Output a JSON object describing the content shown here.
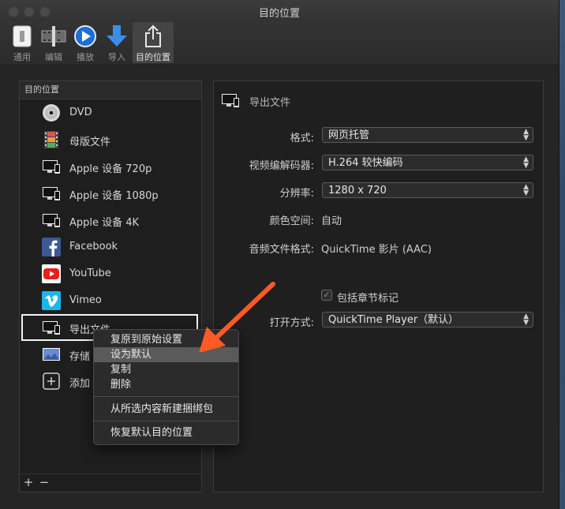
{
  "window": {
    "title": "目的位置"
  },
  "toolbar": {
    "items": [
      {
        "label": "通用"
      },
      {
        "label": "编辑"
      },
      {
        "label": "播放"
      },
      {
        "label": "导入"
      },
      {
        "label": "目的位置"
      }
    ]
  },
  "destinations": {
    "header": "目的位置",
    "items": [
      {
        "label": "DVD",
        "icon": "dvd-disc-icon"
      },
      {
        "label": "母版文件",
        "icon": "film-strip-icon"
      },
      {
        "label": "Apple 设备 720p",
        "icon": "devices-icon"
      },
      {
        "label": "Apple 设备 1080p",
        "icon": "devices-icon"
      },
      {
        "label": "Apple 设备 4K",
        "icon": "devices-icon"
      },
      {
        "label": "Facebook",
        "icon": "facebook-icon"
      },
      {
        "label": "YouTube",
        "icon": "youtube-icon"
      },
      {
        "label": "Vimeo",
        "icon": "vimeo-icon"
      },
      {
        "label": "导出文件",
        "icon": "devices-icon"
      },
      {
        "label": "存储",
        "icon": "image-sequence-icon"
      },
      {
        "label": "添加",
        "icon": "add-icon"
      }
    ],
    "footer_add": "+",
    "footer_remove": "−"
  },
  "detail": {
    "title": "导出文件",
    "format_label": "格式:",
    "format_value": "网页托管",
    "codec_label": "视频编解码器:",
    "codec_value": "H.264 较快编码",
    "resolution_label": "分辨率:",
    "resolution_value": "1280 x 720",
    "colorspace_label": "颜色空间:",
    "colorspace_value": "自动",
    "audio_label": "音频文件格式:",
    "audio_value": "QuickTime 影片 (AAC)",
    "chapters_label": "包括章节标记",
    "chapters_checked": true,
    "open_with_label": "打开方式:",
    "open_with_value": "QuickTime Player（默认）"
  },
  "context_menu": {
    "items": [
      "复原到原始设置",
      "设为默认",
      "复制",
      "删除",
      "从所选内容新建捆绑包",
      "恢复默认目的位置"
    ]
  },
  "colors": {
    "annotation_arrow": "#ff5a26",
    "accent_blue": "#1a6fd8",
    "facebook_blue": "#3b5998",
    "youtube_red": "#e62117",
    "vimeo_blue": "#1ab7ea"
  }
}
